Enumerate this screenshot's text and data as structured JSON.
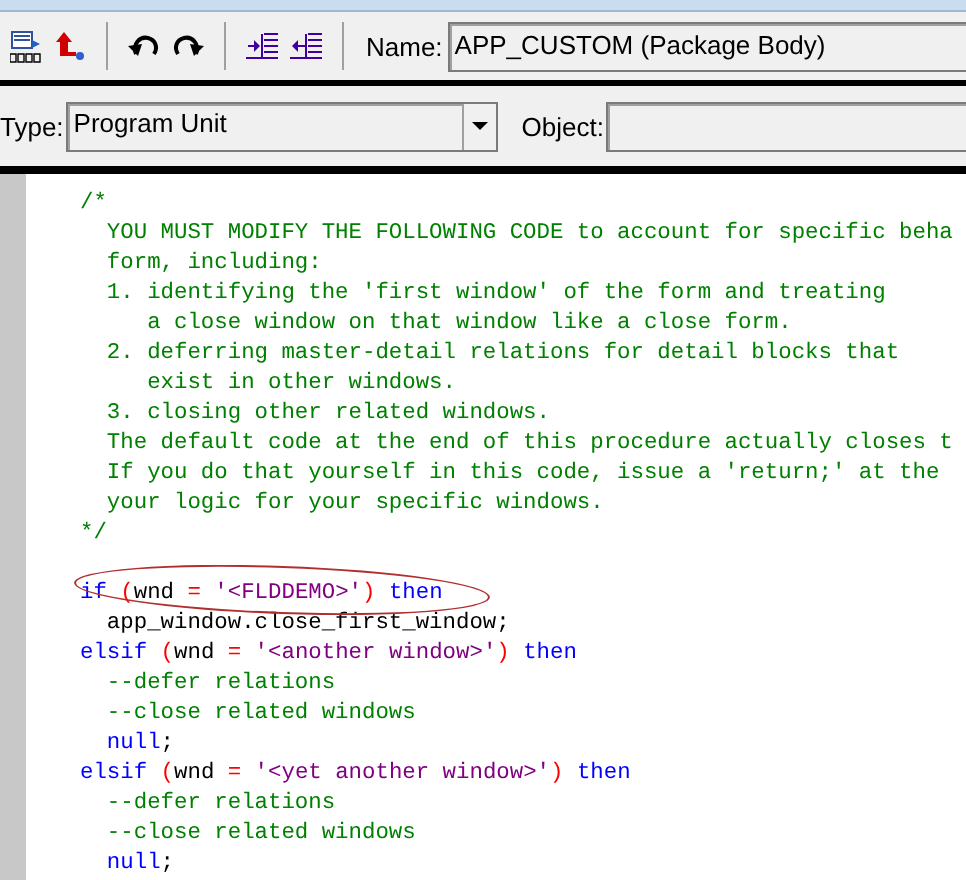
{
  "toolbar": {
    "name_field": {
      "label": "Name:",
      "value": "APP_CUSTOM (Package Body)"
    }
  },
  "selectors": {
    "type_field": {
      "label": "Type:",
      "value": "Program Unit"
    },
    "object_field": {
      "label": "Object:"
    }
  },
  "editor": {
    "lines": [
      {
        "kind": "code",
        "tokens": [
          {
            "kind": "comment",
            "text": "/*"
          }
        ]
      },
      {
        "kind": "code",
        "tokens": [
          {
            "kind": "comment",
            "text": "  YOU MUST MODIFY THE FOLLOWING CODE to account for specific beha"
          }
        ]
      },
      {
        "kind": "code",
        "tokens": [
          {
            "kind": "comment",
            "text": "  form, including:"
          }
        ]
      },
      {
        "kind": "code",
        "tokens": [
          {
            "kind": "comment",
            "text": "  1. identifying the 'first window' of the form and treating"
          }
        ]
      },
      {
        "kind": "code",
        "tokens": [
          {
            "kind": "comment",
            "text": "     a close window on that window like a close form."
          }
        ]
      },
      {
        "kind": "code",
        "tokens": [
          {
            "kind": "comment",
            "text": "  2. deferring master-detail relations for detail blocks that"
          }
        ]
      },
      {
        "kind": "code",
        "tokens": [
          {
            "kind": "comment",
            "text": "     exist in other windows."
          }
        ]
      },
      {
        "kind": "code",
        "tokens": [
          {
            "kind": "comment",
            "text": "  3. closing other related windows."
          }
        ]
      },
      {
        "kind": "code",
        "tokens": [
          {
            "kind": "comment",
            "text": "  The default code at the end of this procedure actually closes t"
          }
        ]
      },
      {
        "kind": "code",
        "tokens": [
          {
            "kind": "comment",
            "text": "  If you do that yourself in this code, issue a 'return;' at the"
          }
        ]
      },
      {
        "kind": "code",
        "tokens": [
          {
            "kind": "comment",
            "text": "  your logic for your specific windows."
          }
        ]
      },
      {
        "kind": "code",
        "tokens": [
          {
            "kind": "comment",
            "text": "*/"
          }
        ]
      },
      {
        "kind": "blank"
      },
      {
        "kind": "code",
        "circled": true,
        "tokens": [
          {
            "kind": "keyword",
            "text": "if"
          },
          {
            "kind": "operator",
            "text": " ("
          },
          {
            "kind": "plain",
            "text": "wnd "
          },
          {
            "kind": "operator",
            "text": "="
          },
          {
            "kind": "string",
            "text": " '<FLDDEMO>'"
          },
          {
            "kind": "operator",
            "text": ")"
          },
          {
            "kind": "keyword",
            "text": " then"
          }
        ]
      },
      {
        "kind": "code",
        "tokens": [
          {
            "kind": "plain",
            "text": "  app_window.close_first_window;"
          }
        ]
      },
      {
        "kind": "code",
        "tokens": [
          {
            "kind": "keyword",
            "text": "elsif"
          },
          {
            "kind": "operator",
            "text": " ("
          },
          {
            "kind": "plain",
            "text": "wnd "
          },
          {
            "kind": "operator",
            "text": "="
          },
          {
            "kind": "string",
            "text": " '<another window>'"
          },
          {
            "kind": "operator",
            "text": ")"
          },
          {
            "kind": "keyword",
            "text": " then"
          }
        ]
      },
      {
        "kind": "code",
        "tokens": [
          {
            "kind": "comment",
            "text": "  --defer relations"
          }
        ]
      },
      {
        "kind": "code",
        "tokens": [
          {
            "kind": "comment",
            "text": "  --close related windows"
          }
        ]
      },
      {
        "kind": "code",
        "tokens": [
          {
            "kind": "keyword",
            "text": "  null"
          },
          {
            "kind": "plain",
            "text": ";"
          }
        ]
      },
      {
        "kind": "code",
        "tokens": [
          {
            "kind": "keyword",
            "text": "elsif"
          },
          {
            "kind": "operator",
            "text": " ("
          },
          {
            "kind": "plain",
            "text": "wnd "
          },
          {
            "kind": "operator",
            "text": "="
          },
          {
            "kind": "string",
            "text": " '<yet another window>'"
          },
          {
            "kind": "operator",
            "text": ")"
          },
          {
            "kind": "keyword",
            "text": " then"
          }
        ]
      },
      {
        "kind": "code",
        "tokens": [
          {
            "kind": "comment",
            "text": "  --defer relations"
          }
        ]
      },
      {
        "kind": "code",
        "tokens": [
          {
            "kind": "comment",
            "text": "  --close related windows"
          }
        ]
      },
      {
        "kind": "code",
        "tokens": [
          {
            "kind": "keyword",
            "text": "  null"
          },
          {
            "kind": "plain",
            "text": ";"
          }
        ]
      }
    ]
  }
}
